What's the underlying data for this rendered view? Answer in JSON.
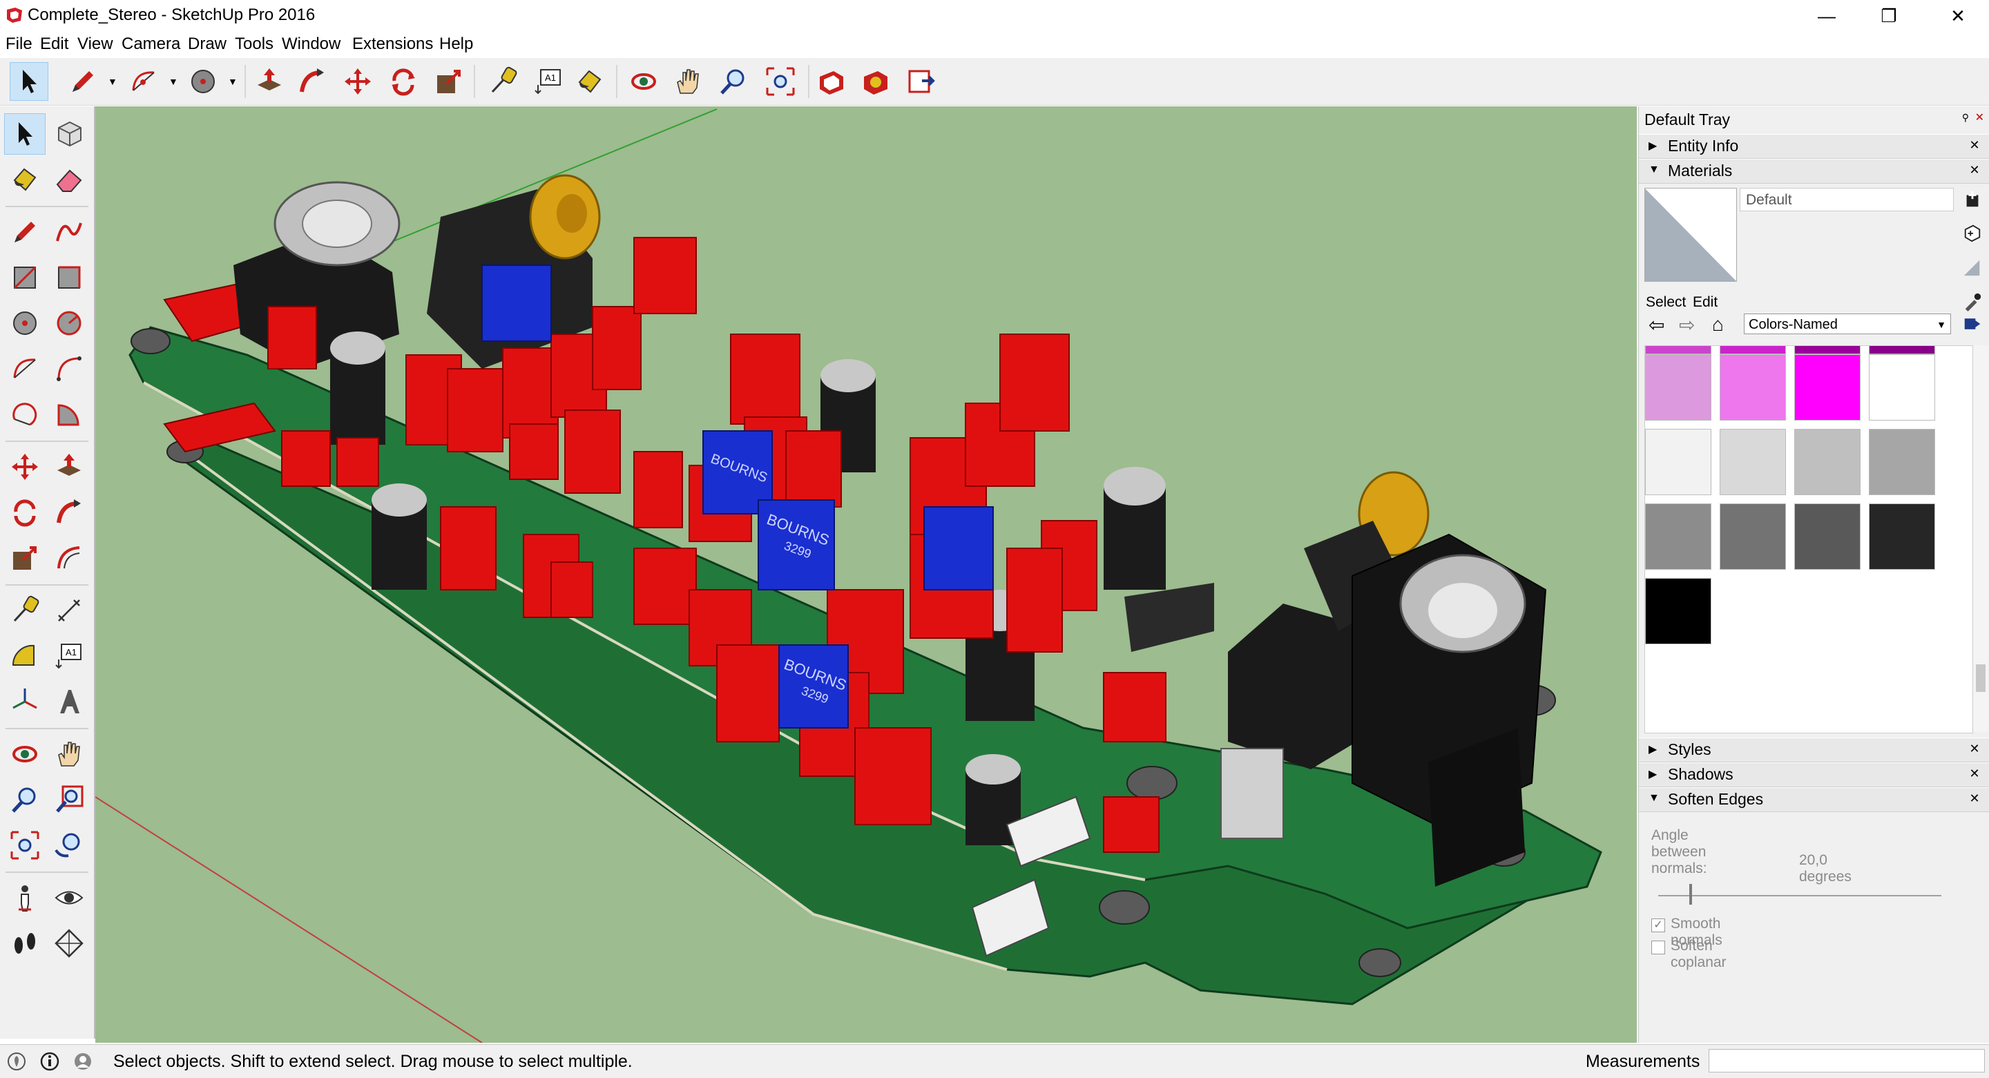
{
  "window": {
    "title": "Complete_Stereo - SketchUp Pro 2016",
    "minimize": "—",
    "maximize": "❐",
    "close": "✕"
  },
  "menu": [
    "File",
    "Edit",
    "View",
    "Camera",
    "Draw",
    "Tools",
    "Window",
    "Extensions",
    "Help"
  ],
  "toolbar": {
    "label_tool_text": "A1"
  },
  "lefttoolbar": {
    "label_tool_text": "A1"
  },
  "tray": {
    "title": "Default Tray",
    "pin": "⚲",
    "close": "✕",
    "panels": {
      "entity_info": "Entity Info",
      "materials": "Materials",
      "styles": "Styles",
      "shadows": "Shadows",
      "soften_edges": "Soften Edges"
    },
    "collapsed_arrow": "▶",
    "expanded_arrow": "▼",
    "panel_close": "✕",
    "materials": {
      "name_value": "Default",
      "tab_select": "Select",
      "tab_edit": "Edit",
      "nav_back": "⇦",
      "nav_forward": "⇨",
      "nav_home": "⌂",
      "library": "Colors-Named",
      "caret": "▼",
      "swatch_colors": [
        "#cc44cc",
        "#cc22cc",
        "#990099",
        "#880088",
        "#dd99dd",
        "#ee77ee",
        "#ff00ff",
        "#ffffff",
        "#f2f2f2",
        "#d9d9d9",
        "#bfbfbf",
        "#a6a6a6",
        "#8c8c8c",
        "#737373",
        "#595959",
        "#262626",
        "#000000"
      ]
    },
    "soften": {
      "angle_label": "Angle between normals:",
      "angle_value": "20,0  degrees",
      "smooth_normals": "Smooth normals",
      "soften_coplanar": "Soften coplanar",
      "smooth_checked": true,
      "coplanar_checked": false,
      "slider_fraction": 0.11
    }
  },
  "status": {
    "hint": "Select objects. Shift to extend select. Drag mouse to select multiple.",
    "measurements_label": "Measurements",
    "measurements_value": ""
  },
  "viewport": {
    "background": "#9dbc8f",
    "pcb_color": "#1f7a3a",
    "component_red": "#e01010",
    "trimpot_blue": "#1a2fd0",
    "trimpot_label": "BOURNS",
    "trimpot_code": "3299"
  }
}
